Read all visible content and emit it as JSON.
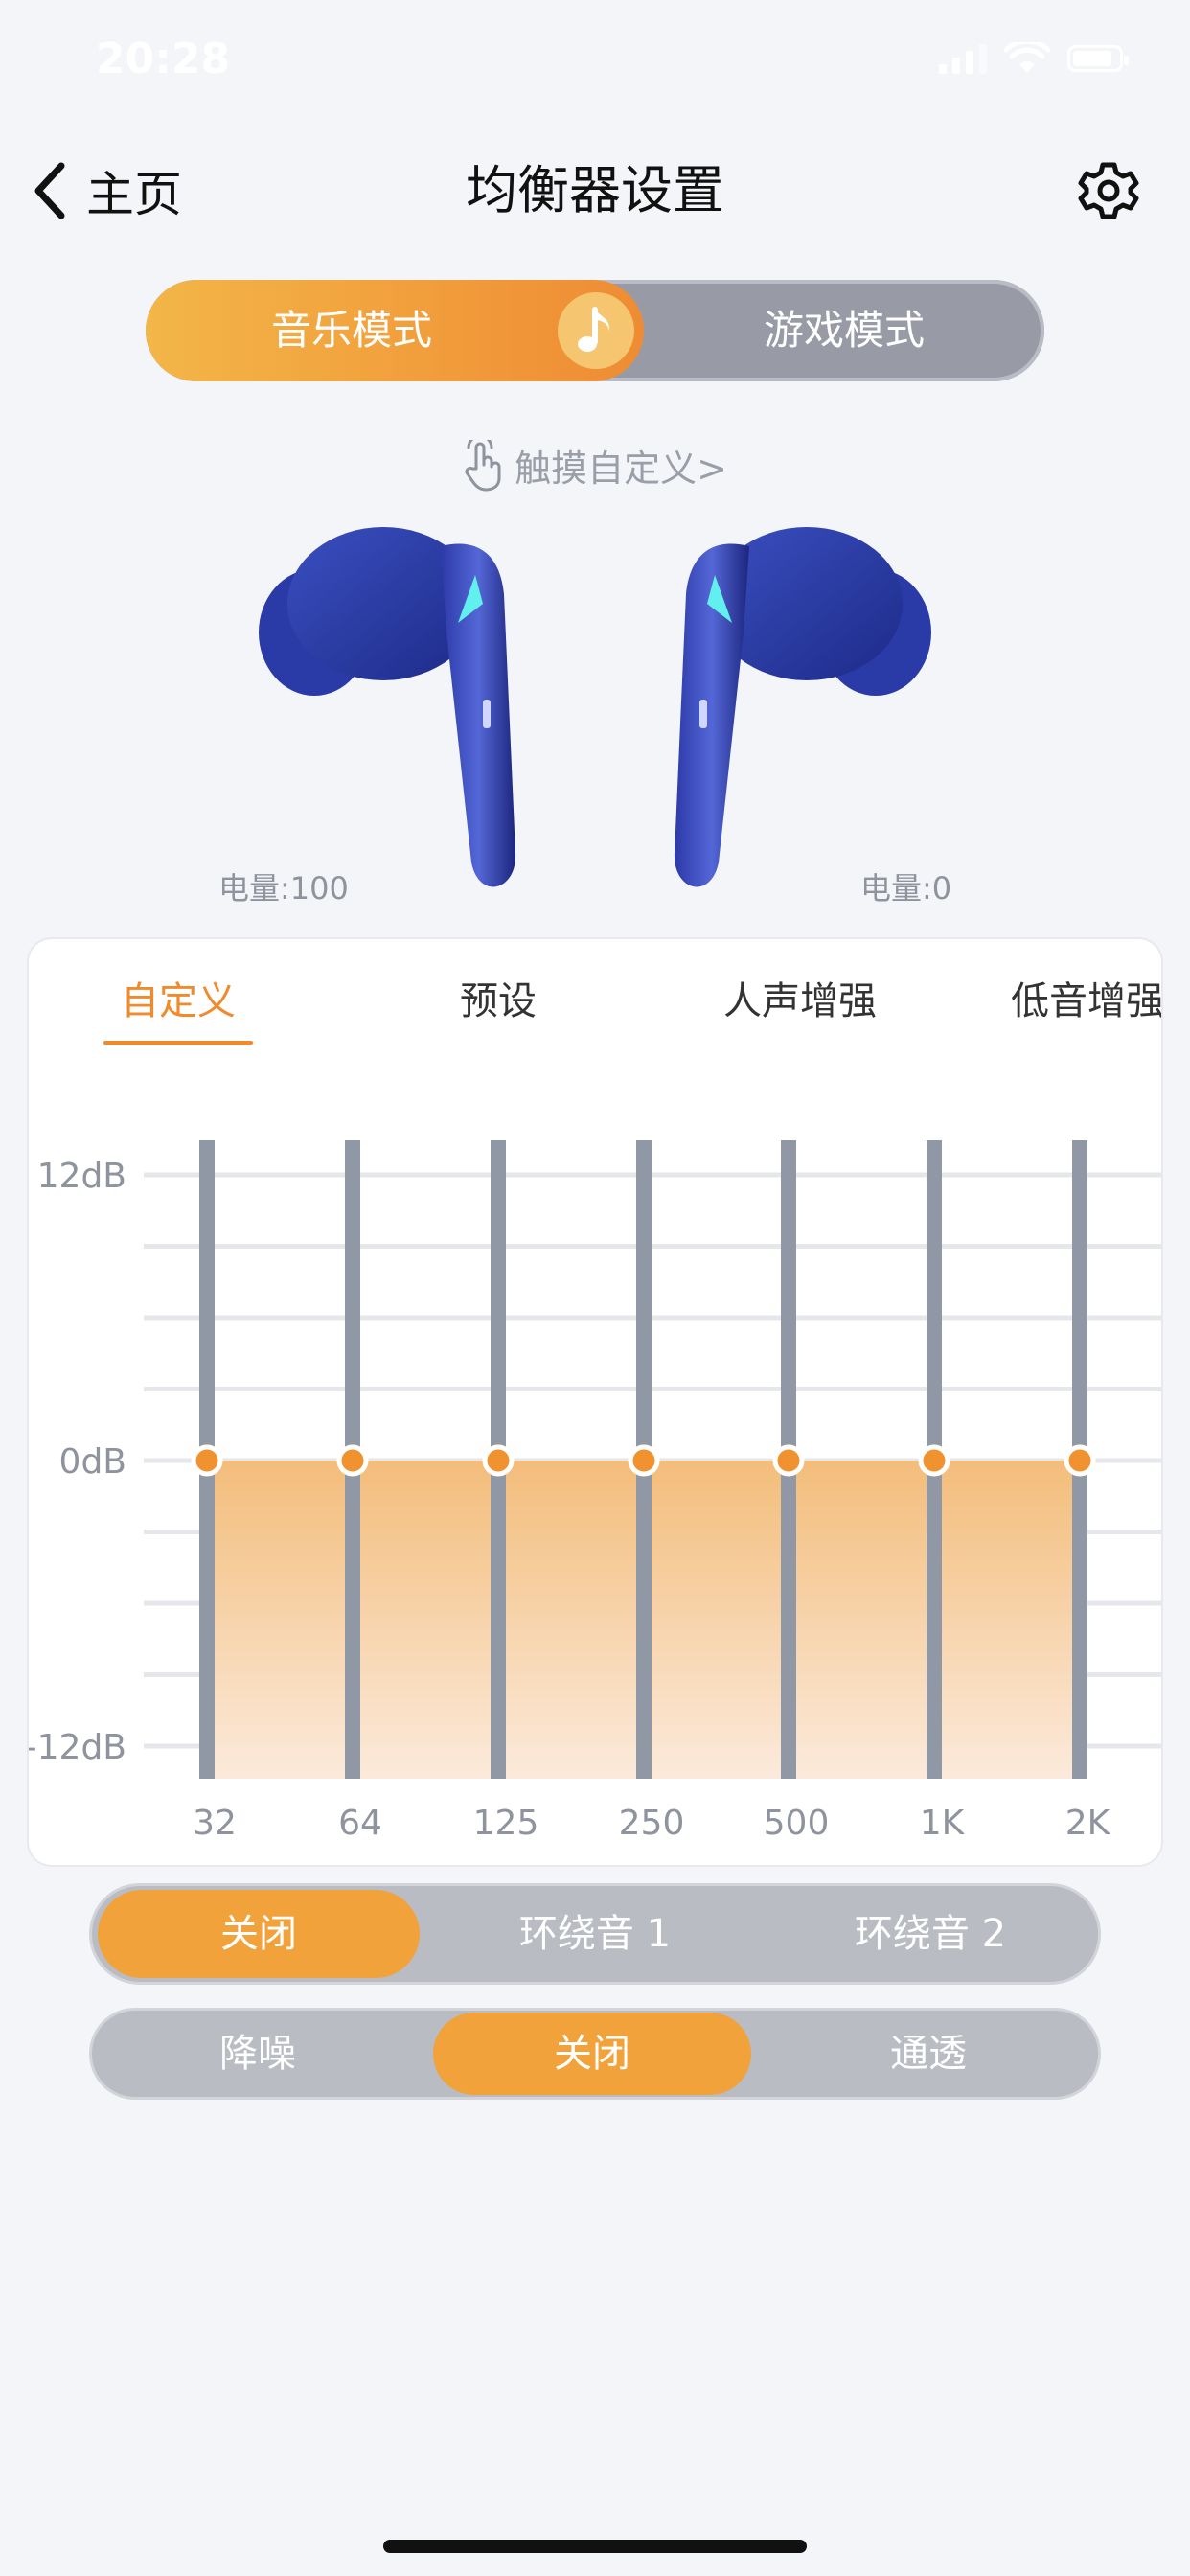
{
  "status_bar": {
    "time": "20:28"
  },
  "nav": {
    "back_label": "主页",
    "title": "均衡器设置"
  },
  "mode_toggle": {
    "options": [
      "音乐模式",
      "游戏模式"
    ],
    "selected": "音乐模式"
  },
  "touch_link": "触摸自定义>",
  "battery": {
    "left": "电量:100",
    "right": "电量:0"
  },
  "eq_tabs": {
    "items": [
      "自定义",
      "预设",
      "人声增强",
      "低音增强"
    ],
    "selected": "自定义"
  },
  "chart_data": {
    "type": "line",
    "x": [
      "32",
      "64",
      "125",
      "250",
      "500",
      "1K",
      "2K"
    ],
    "values": [
      0,
      0,
      0,
      0,
      0,
      0,
      0
    ],
    "ylim": [
      -12,
      12
    ],
    "ytick_labels": [
      "12dB",
      "0dB",
      "-12dB"
    ],
    "accent_color": "#f0922f"
  },
  "surround": {
    "options": [
      "关闭",
      "环绕音 1",
      "环绕音 2"
    ],
    "selected": "关闭"
  },
  "noise_control": {
    "options": [
      "降噪",
      "关闭",
      "通透"
    ],
    "selected": "关闭"
  },
  "colors": {
    "accent": "#f0922f",
    "inactive": "#989ba6",
    "background": "#f3f5f8"
  }
}
